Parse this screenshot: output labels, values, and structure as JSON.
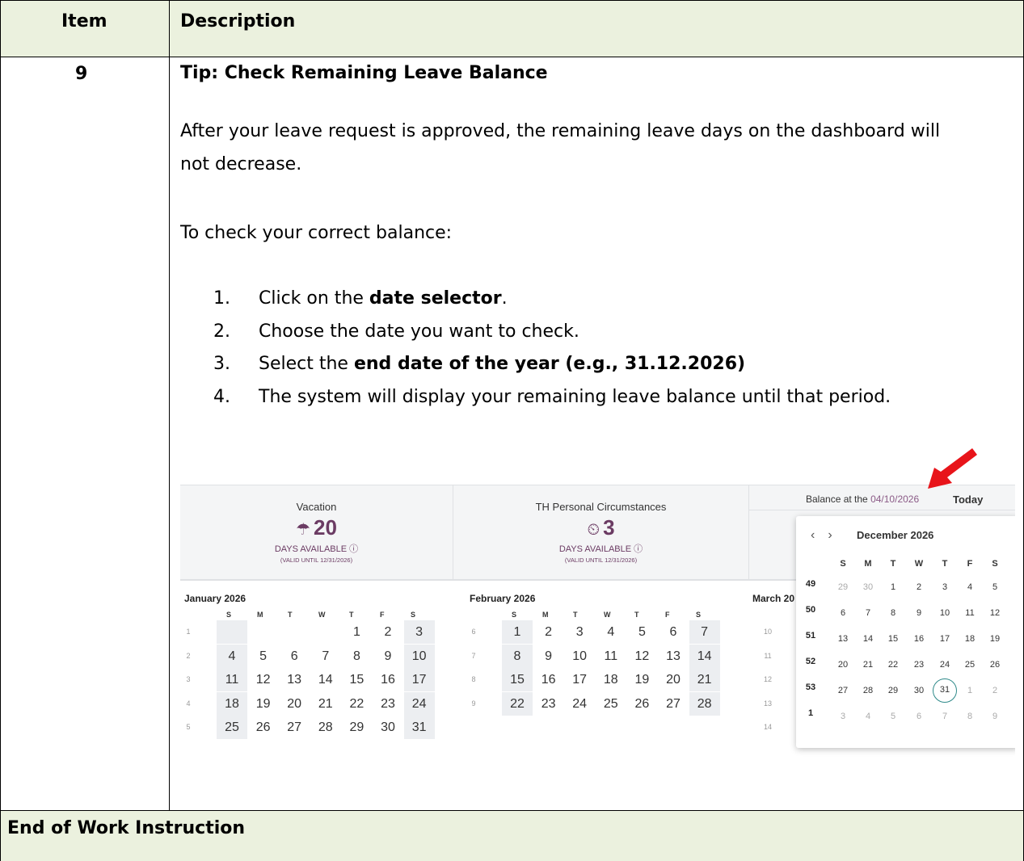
{
  "table": {
    "header_item": "Item",
    "header_description": "Description",
    "row_number": "9",
    "tip_title": "Tip: Check Remaining Leave Balance",
    "para1_line1": "After your leave request is approved, the remaining leave days on the dashboard will",
    "para1_line2": "not decrease.",
    "para2": "To check your correct balance:",
    "steps": [
      {
        "num": "1.",
        "before": "Click on the ",
        "bold": "date selector",
        "after": "."
      },
      {
        "num": "2.",
        "before": "Choose the date you want to check.",
        "bold": "",
        "after": ""
      },
      {
        "num": "3.",
        "before": "Select the ",
        "bold": "end date of the year (e.g., 31.12.2026)",
        "after": ""
      },
      {
        "num": "4.",
        "before": "The system will display your remaining leave balance until that period.",
        "bold": "",
        "after": ""
      }
    ],
    "footer": "End of Work Instruction"
  },
  "screenshot": {
    "cards": [
      {
        "title": "Vacation",
        "icon": "umbrella-icon",
        "icon_glyph": "☂",
        "days": "20",
        "label": "DAYS AVAILABLE ⓘ",
        "valid": "(VALID UNTIL 12/31/2026)"
      },
      {
        "title": "TH Personal Circumstances",
        "icon": "timer-icon",
        "icon_glyph": "⏲",
        "days": "3",
        "label": "DAYS AVAILABLE ⓘ",
        "valid": "(VALID UNTIL 12/31/2026)"
      }
    ],
    "balance_label": "Balance at the",
    "balance_date": "04/10/2026",
    "today_label": "Today",
    "day_headers": [
      "S",
      "M",
      "T",
      "W",
      "T",
      "F",
      "S"
    ],
    "months": [
      {
        "title": "January 2026",
        "weeks": [
          {
            "wk": "1",
            "days": [
              "",
              "",
              "",
              "",
              "1",
              "2",
              "3"
            ]
          },
          {
            "wk": "2",
            "days": [
              "4",
              "5",
              "6",
              "7",
              "8",
              "9",
              "10"
            ]
          },
          {
            "wk": "3",
            "days": [
              "11",
              "12",
              "13",
              "14",
              "15",
              "16",
              "17"
            ]
          },
          {
            "wk": "4",
            "days": [
              "18",
              "19",
              "20",
              "21",
              "22",
              "23",
              "24"
            ]
          },
          {
            "wk": "5",
            "days": [
              "25",
              "26",
              "27",
              "28",
              "29",
              "30",
              "31"
            ]
          }
        ]
      },
      {
        "title": "February 2026",
        "weeks": [
          {
            "wk": "6",
            "days": [
              "1",
              "2",
              "3",
              "4",
              "5",
              "6",
              "7"
            ]
          },
          {
            "wk": "7",
            "days": [
              "8",
              "9",
              "10",
              "11",
              "12",
              "13",
              "14"
            ]
          },
          {
            "wk": "8",
            "days": [
              "15",
              "16",
              "17",
              "18",
              "19",
              "20",
              "21"
            ]
          },
          {
            "wk": "9",
            "days": [
              "22",
              "23",
              "24",
              "25",
              "26",
              "27",
              "28"
            ]
          }
        ]
      },
      {
        "title": "March 20",
        "weeks": [
          {
            "wk": "10",
            "days": []
          },
          {
            "wk": "11",
            "days": []
          },
          {
            "wk": "12",
            "days": []
          },
          {
            "wk": "13",
            "days": []
          },
          {
            "wk": "14",
            "days": []
          }
        ]
      }
    ],
    "picker": {
      "prev": "‹",
      "next": "›",
      "title": "December 2026",
      "weeks": [
        {
          "wk": "49",
          "days": [
            "29",
            "30",
            "1",
            "2",
            "3",
            "4",
            "5"
          ],
          "dim": [
            0,
            1
          ]
        },
        {
          "wk": "50",
          "days": [
            "6",
            "7",
            "8",
            "9",
            "10",
            "11",
            "12"
          ],
          "dim": []
        },
        {
          "wk": "51",
          "days": [
            "13",
            "14",
            "15",
            "16",
            "17",
            "18",
            "19"
          ],
          "dim": []
        },
        {
          "wk": "52",
          "days": [
            "20",
            "21",
            "22",
            "23",
            "24",
            "25",
            "26"
          ],
          "dim": []
        },
        {
          "wk": "53",
          "days": [
            "27",
            "28",
            "29",
            "30",
            "31",
            "1",
            "2"
          ],
          "dim": [
            5,
            6
          ]
        },
        {
          "wk": "1",
          "days": [
            "3",
            "4",
            "5",
            "6",
            "7",
            "8",
            "9"
          ],
          "dim": [
            0,
            1,
            2,
            3,
            4,
            5,
            6
          ]
        }
      ],
      "selected": "31"
    },
    "arrow_color": "#e8141a",
    "accent_color": "#6b3b63"
  }
}
